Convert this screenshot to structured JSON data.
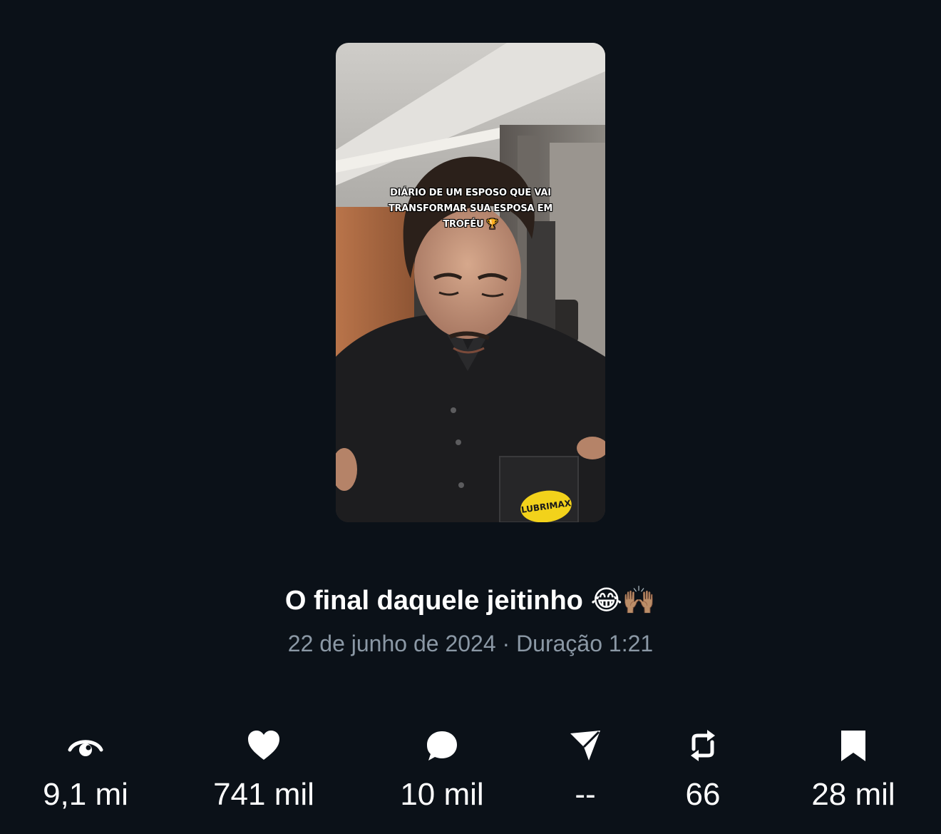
{
  "video": {
    "caption_lines": [
      "DIÁRIO DE UM ESPOSO QUE VAI",
      "TRANSFORMAR SUA ESPOSA EM",
      "TROFÉU 🏆"
    ],
    "shirt_logo": "LUBRIMAX"
  },
  "post": {
    "title": "O final daquele jeitinho 😂🙌🏽",
    "meta": "22 de junho de 2024 · Duração 1:21"
  },
  "stats": [
    {
      "icon": "eye-icon",
      "value": "9,1 mi"
    },
    {
      "icon": "heart-icon",
      "value": "741 mil"
    },
    {
      "icon": "comment-icon",
      "value": "10 mil"
    },
    {
      "icon": "send-icon",
      "value": "--"
    },
    {
      "icon": "repost-icon",
      "value": "66"
    },
    {
      "icon": "bookmark-icon",
      "value": "28 mil"
    }
  ],
  "colors": {
    "background": "#0b1118",
    "text": "#ffffff",
    "muted_text": "#8b98a5"
  }
}
